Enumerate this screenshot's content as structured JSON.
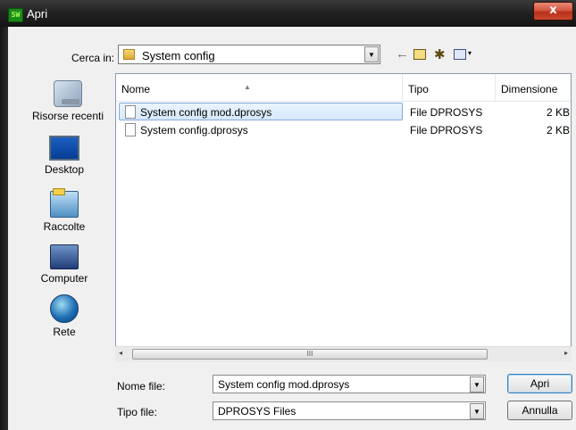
{
  "window": {
    "title": "Apri",
    "close_label": "x",
    "app_icon_label": "SW"
  },
  "toolbar": {
    "lookin_label": "Cerca in:",
    "lookin_value": "System config",
    "back_glyph": "←",
    "up_glyph": "⮤",
    "new_glyph": "✱",
    "views_glyph": "▾"
  },
  "places": [
    {
      "label": "Risorse recenti",
      "icon": "recent-places-icon"
    },
    {
      "label": "Desktop",
      "icon": "desktop-icon"
    },
    {
      "label": "Raccolte",
      "icon": "libraries-icon"
    },
    {
      "label": "Computer",
      "icon": "computer-icon"
    },
    {
      "label": "Rete",
      "icon": "network-icon"
    }
  ],
  "filelist": {
    "columns": [
      "Nome",
      "Tipo",
      "Dimensione"
    ],
    "rows": [
      {
        "name": "System config mod.dprosys",
        "type": "File DPROSYS",
        "size": "2 KB",
        "selected": true
      },
      {
        "name": "System config.dprosys",
        "type": "File DPROSYS",
        "size": "2 KB",
        "selected": false
      }
    ],
    "scroll_grip": "III",
    "scroll_left": "◂",
    "scroll_right": "▸"
  },
  "bottom": {
    "filename_label": "Nome file:",
    "filename_value": "System config mod.dprosys",
    "filetype_label": "Tipo file:",
    "filetype_value": "DPROSYS Files",
    "open_button": "Apri",
    "cancel_button": "Annulla"
  }
}
